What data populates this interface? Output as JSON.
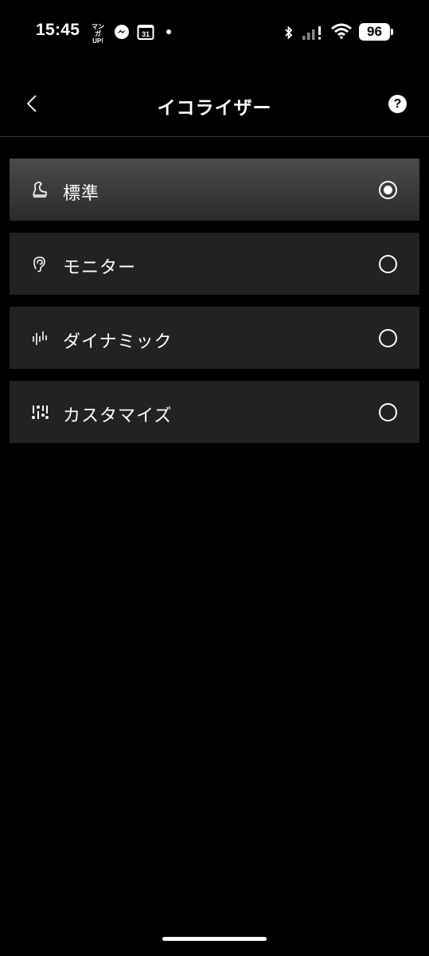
{
  "status_bar": {
    "time": "15:45",
    "manga_icon_text": "マンガ UP!",
    "calendar_day": "31",
    "battery": "96"
  },
  "header": {
    "title": "イコライザー",
    "back_icon": "chevron-left-icon",
    "help_label": "?"
  },
  "equalizer": {
    "items": [
      {
        "label": "標準",
        "icon": "gramophone-icon",
        "selected": true
      },
      {
        "label": "モニター",
        "icon": "ear-icon",
        "selected": false
      },
      {
        "label": "ダイナミック",
        "icon": "waveform-icon",
        "selected": false
      },
      {
        "label": "カスタマイズ",
        "icon": "sliders-icon",
        "selected": false
      }
    ]
  }
}
